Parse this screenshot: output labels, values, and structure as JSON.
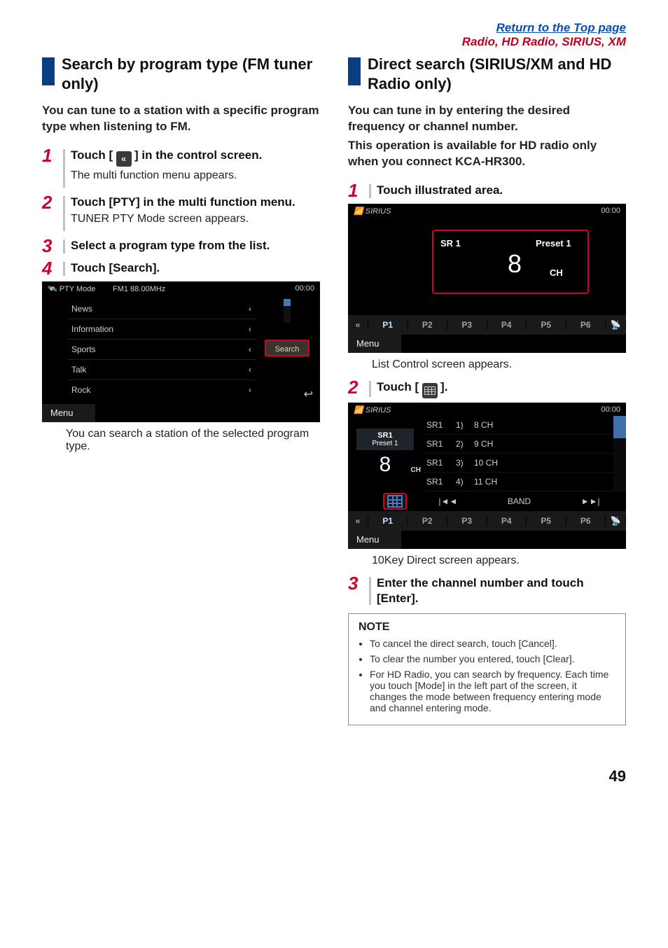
{
  "header": {
    "top_link": "Return to the Top page",
    "section_name": "Radio, HD Radio, SIRIUS, XM"
  },
  "left": {
    "heading": "Search by program type (FM tuner only)",
    "intro": "You can tune to a station with a specific program type when listening to FM.",
    "steps": {
      "one": {
        "num": "1",
        "title_pre": "Touch [",
        "icon_glyph": "«",
        "title_post": " ] in the control screen.",
        "desc": "The multi function menu appears."
      },
      "two": {
        "num": "2",
        "title": "Touch [PTY] in the multi function menu.",
        "desc": "TUNER PTY Mode screen appears."
      },
      "three": {
        "num": "3",
        "title": "Select a program type from the list."
      },
      "four": {
        "num": "4",
        "title": "Touch [Search]."
      }
    },
    "shot": {
      "title": "PTY Mode",
      "freq": "FM1 88.00MHz",
      "time": "00:00",
      "rows": [
        "News",
        "Information",
        "Sports",
        "Talk",
        "Rock"
      ],
      "search_btn": "Search",
      "menu": "Menu"
    },
    "after_shot": "You can search a station of the selected program type."
  },
  "right": {
    "heading": "Direct search (SIRIUS/XM and HD Radio only)",
    "intro_p1": "You can tune in by entering the desired frequency or channel number.",
    "intro_p2": "This operation is available for HD radio only when you connect KCA-HR300.",
    "steps": {
      "one": {
        "num": "1",
        "title": "Touch illustrated area."
      },
      "two": {
        "num": "2",
        "title_pre": "Touch [",
        "title_post": " ]."
      },
      "three": {
        "num": "3",
        "title": "Enter the channel number and touch [Enter]."
      }
    },
    "shot2": {
      "title": "SIRIUS",
      "time": "00:00",
      "sr": "SR 1",
      "preset": "Preset 1",
      "big": "8",
      "ch": "CH",
      "presets": [
        "P1",
        "P2",
        "P3",
        "P4",
        "P5",
        "P6"
      ],
      "menu": "Menu"
    },
    "after_shot2": "List Control screen appears.",
    "shot3": {
      "title": "SIRIUS",
      "time": "00:00",
      "left_sr": "SR1",
      "left_preset": "Preset 1",
      "left_big": "8",
      "left_ch": "CH",
      "rows": [
        {
          "c1": "SR1",
          "c2": "1)",
          "c3": "8 CH"
        },
        {
          "c1": "SR1",
          "c2": "2)",
          "c3": "9 CH"
        },
        {
          "c1": "SR1",
          "c2": "3)",
          "c3": "10 CH"
        },
        {
          "c1": "SR1",
          "c2": "4)",
          "c3": "11 CH"
        }
      ],
      "ctrl_prev": "|◄◄",
      "ctrl_band": "BAND",
      "ctrl_next": "►►|",
      "presets": [
        "P1",
        "P2",
        "P3",
        "P4",
        "P5",
        "P6"
      ],
      "menu": "Menu"
    },
    "after_shot3": "10Key Direct screen appears.",
    "note": {
      "heading": "NOTE",
      "items": [
        "To cancel the direct search, touch [Cancel].",
        "To clear the number you entered, touch [Clear].",
        "For HD Radio, you can search by frequency. Each time you touch [Mode] in the left part of the screen, it changes the mode between frequency entering mode and channel entering mode."
      ]
    }
  },
  "page_number": "49"
}
